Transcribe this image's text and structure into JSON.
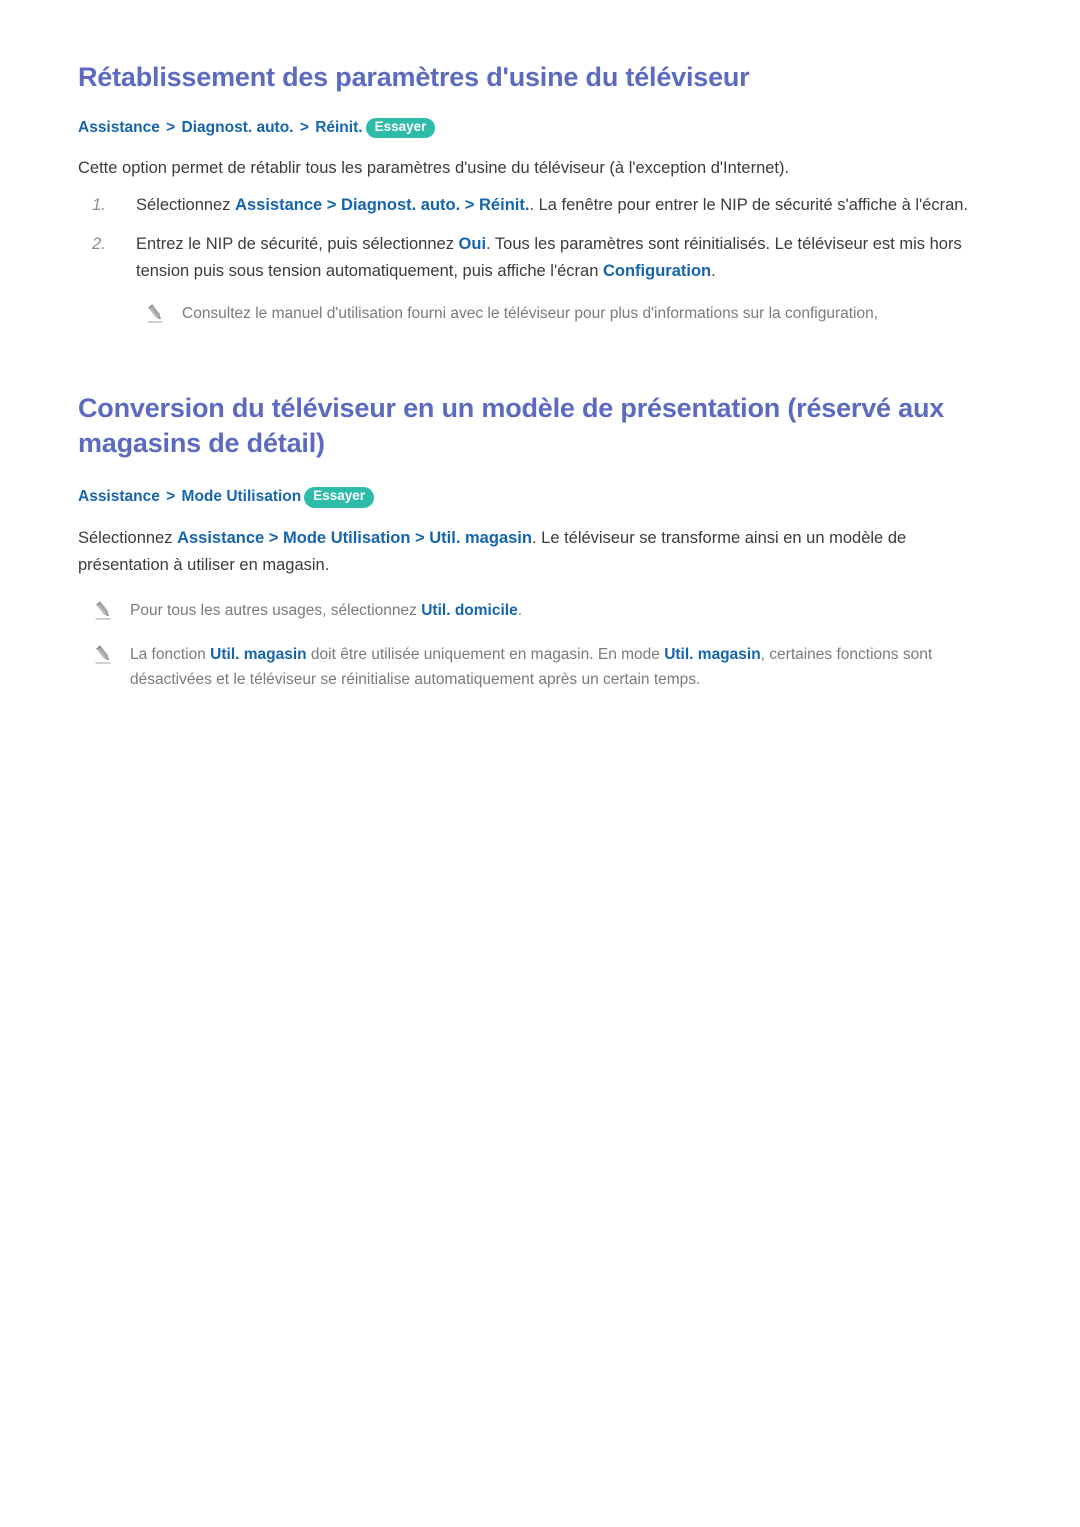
{
  "document": {
    "language": "fr",
    "colors": {
      "heading": "#5C6BC0",
      "link": "#1565AD",
      "badge_background": "#2EBCAA",
      "badge_text": "#FFFFFF",
      "body_text": "#3B3B3B",
      "note_text": "#7B7B7B",
      "list_marker": "#8D8D8D",
      "page_background": "#FFFFFF"
    }
  },
  "sections": [
    {
      "title": "Rétablissement des paramètres d'usine du téléviseur",
      "breadcrumb": {
        "crumbs": [
          "Assistance",
          "Diagnost. auto.",
          "Réinit."
        ],
        "separator": ">",
        "badge": "Essayer"
      },
      "intro": "Cette option permet de rétablir tous les paramètres d'usine du téléviseur (à l'exception d'Internet).",
      "steps": [
        {
          "marker": "1.",
          "parts": [
            {
              "text": "Sélectionnez ",
              "style": "plain"
            },
            {
              "text": "Assistance",
              "style": "link"
            },
            {
              "text": " > ",
              "style": "plain"
            },
            {
              "text": "Diagnost. auto.",
              "style": "link"
            },
            {
              "text": " > ",
              "style": "plain"
            },
            {
              "text": "Réinit.",
              "style": "link"
            },
            {
              "text": ". La fenêtre pour entrer le NIP de sécurité s'affiche à l'écran.",
              "style": "plain"
            }
          ]
        },
        {
          "marker": "2.",
          "parts": [
            {
              "text": "Entrez le NIP de sécurité, puis sélectionnez ",
              "style": "plain"
            },
            {
              "text": "Oui",
              "style": "link"
            },
            {
              "text": ". Tous les paramètres sont réinitialisés. Le téléviseur est mis hors tension puis sous tension automatiquement, puis affiche l'écran ",
              "style": "plain"
            },
            {
              "text": "Configuration",
              "style": "link"
            },
            {
              "text": ".",
              "style": "plain"
            }
          ]
        }
      ],
      "notes": [
        {
          "icon": "pencil-icon",
          "parts": [
            {
              "text": "Consultez le manuel d'utilisation fourni avec le téléviseur pour plus d'informations sur la configuration,",
              "style": "plain"
            }
          ]
        }
      ]
    },
    {
      "title": "Conversion du téléviseur en un modèle de présentation (réservé aux magasins de détail)",
      "breadcrumb": {
        "crumbs": [
          "Assistance",
          "Mode Utilisation"
        ],
        "separator": ">",
        "badge": "Essayer"
      },
      "intro_parts": [
        {
          "text": "Sélectionnez ",
          "style": "plain"
        },
        {
          "text": "Assistance",
          "style": "link"
        },
        {
          "text": " > ",
          "style": "plain"
        },
        {
          "text": "Mode Utilisation",
          "style": "link"
        },
        {
          "text": " > ",
          "style": "plain"
        },
        {
          "text": "Util. magasin",
          "style": "link"
        },
        {
          "text": ". Le téléviseur se transforme ainsi en un modèle de présentation à utiliser en magasin.",
          "style": "plain"
        }
      ],
      "notes": [
        {
          "icon": "pencil-icon",
          "parts": [
            {
              "text": "Pour tous les autres usages, sélectionnez ",
              "style": "plain"
            },
            {
              "text": "Util. domicile",
              "style": "link"
            },
            {
              "text": ".",
              "style": "plain"
            }
          ]
        },
        {
          "icon": "pencil-icon",
          "parts": [
            {
              "text": "La fonction ",
              "style": "plain"
            },
            {
              "text": "Util. magasin",
              "style": "link"
            },
            {
              "text": " doit être utilisée uniquement en magasin. En mode ",
              "style": "plain"
            },
            {
              "text": "Util. magasin",
              "style": "link"
            },
            {
              "text": ", certaines fonctions sont désactivées et le téléviseur se réinitialise automatiquement après un certain temps.",
              "style": "plain"
            }
          ]
        }
      ]
    }
  ]
}
